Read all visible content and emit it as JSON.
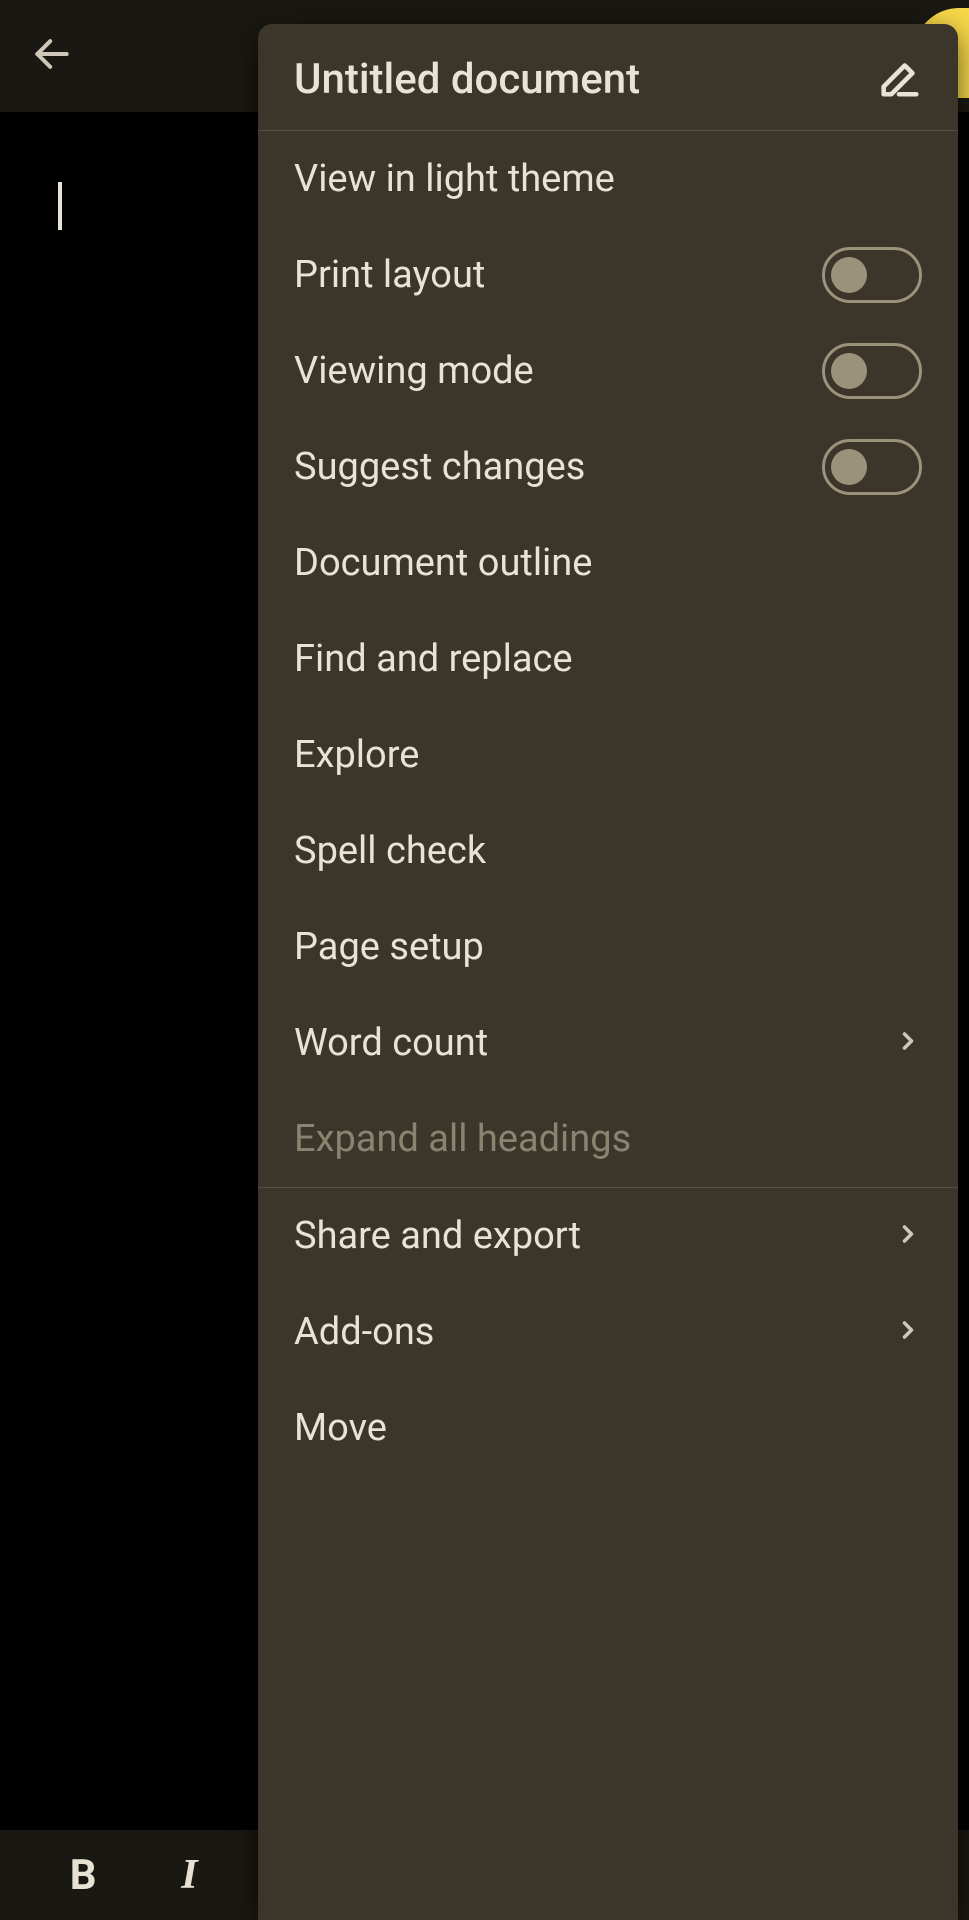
{
  "menu": {
    "title": "Untitled document",
    "items": [
      {
        "label": "View in light theme"
      },
      {
        "label": "Print layout",
        "toggle": false
      },
      {
        "label": "Viewing mode",
        "toggle": false
      },
      {
        "label": "Suggest changes",
        "toggle": false
      },
      {
        "label": "Document outline"
      },
      {
        "label": "Find and replace"
      },
      {
        "label": "Explore"
      },
      {
        "label": "Spell check"
      },
      {
        "label": "Page setup"
      },
      {
        "label": "Word count",
        "chevron": true
      },
      {
        "label": "Expand all headings",
        "disabled": true
      },
      {
        "label": "Share and export",
        "chevron": true
      },
      {
        "label": "Add-ons",
        "chevron": true
      },
      {
        "label": "Move"
      }
    ]
  },
  "toolbar": {
    "bold": "B",
    "italic": "I"
  }
}
